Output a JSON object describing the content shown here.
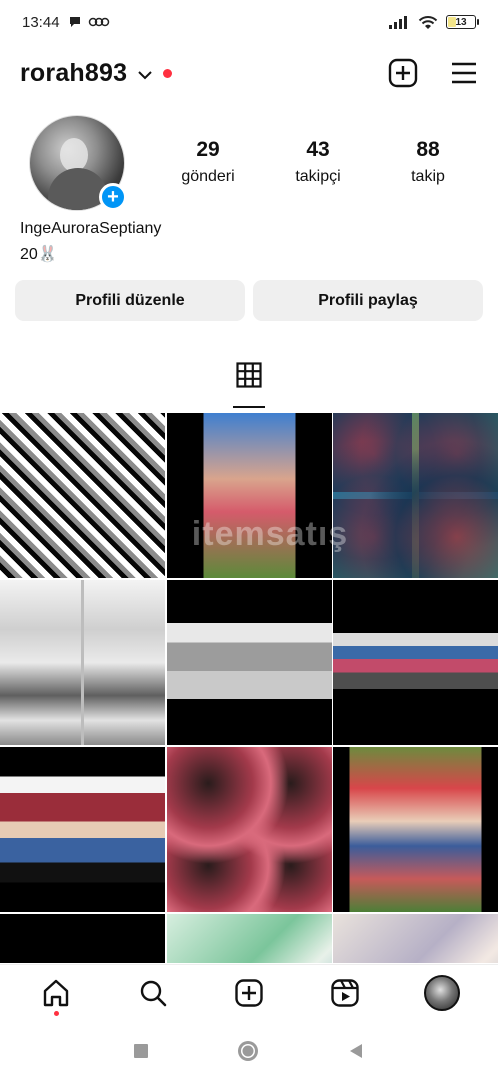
{
  "status_bar": {
    "time": "13:44",
    "battery": "13",
    "battery_level_percent": 13
  },
  "header": {
    "username": "rorah893",
    "icons": [
      "chevron-down-icon",
      "notification-dot",
      "create-post-icon",
      "menu-icon"
    ]
  },
  "profile": {
    "stats": [
      {
        "value": "29",
        "label": "gönderi"
      },
      {
        "value": "43",
        "label": "takipçi"
      },
      {
        "value": "88",
        "label": "takip"
      }
    ],
    "full_name": "IngeAuroraSeptiany",
    "bio": "20🐰"
  },
  "buttons": {
    "edit": "Profili düzenle",
    "share": "Profili paylaş"
  },
  "tabs": {
    "active": "grid-icon"
  },
  "posts_count_visible": 12,
  "watermark": "itemsatış",
  "colors": {
    "accent_blue": "#0095f6",
    "notification_red": "#ff3040",
    "button_bg": "#efefef"
  },
  "bottom_nav": [
    "home-icon",
    "search-icon",
    "create-icon",
    "reels-icon",
    "profile-avatar"
  ],
  "system_nav": [
    "recents-button",
    "home-button",
    "back-button"
  ]
}
